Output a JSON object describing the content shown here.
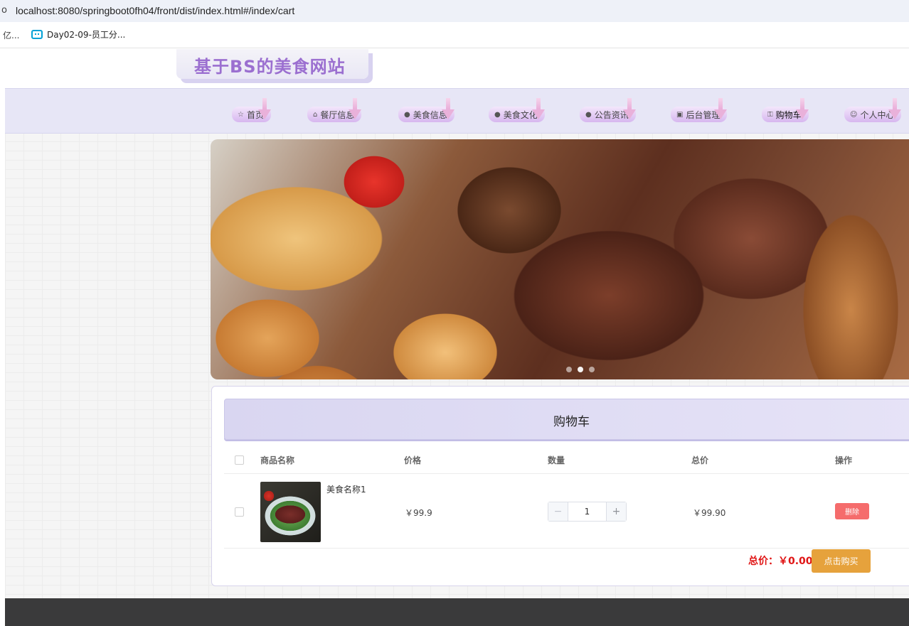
{
  "browser": {
    "url": "localhost:8080/springboot0fh04/front/dist/index.html#/index/cart",
    "lead_glyph": "o",
    "bookmark_cut": "亿...",
    "bookmark": "Day02-09-员工分..."
  },
  "site": {
    "logo": "基于BS的美食网站"
  },
  "nav": {
    "items": [
      {
        "label": "首页",
        "icon": "☆"
      },
      {
        "label": "餐厅信息",
        "icon": "⌂"
      },
      {
        "label": "美食信息",
        "icon": "●"
      },
      {
        "label": "美食文化",
        "icon": "●"
      },
      {
        "label": "公告资讯",
        "icon": "●"
      },
      {
        "label": "后台管理",
        "icon": "▣"
      },
      {
        "label": "购物车",
        "icon": "⚿"
      },
      {
        "label": "个人中心",
        "icon": "☺"
      }
    ],
    "active_index": 6
  },
  "cart": {
    "title": "购物车",
    "headers": {
      "name": "商品名称",
      "price": "价格",
      "qty": "数量",
      "subtotal": "总价",
      "action": "操作"
    },
    "items": [
      {
        "name": "美食名称1",
        "price": "￥99.9",
        "quantity": "1",
        "subtotal": "￥99.90",
        "delete_label": "删除",
        "checked": false
      }
    ],
    "total_label": "总价：",
    "total_value": "￥0.00",
    "buy_label": "点击购买",
    "stepper": {
      "minus": "−",
      "plus": "+"
    }
  },
  "colors": {
    "logo": "#9b6fd0",
    "nav_bg": "#e7e6f6",
    "delete_button": "#f56c6c",
    "buy_button": "#e6a23c",
    "total_text": "#e01515",
    "footer": "#3a3a3b"
  },
  "banner": {
    "slide_count": 3,
    "active_slide": 1
  }
}
